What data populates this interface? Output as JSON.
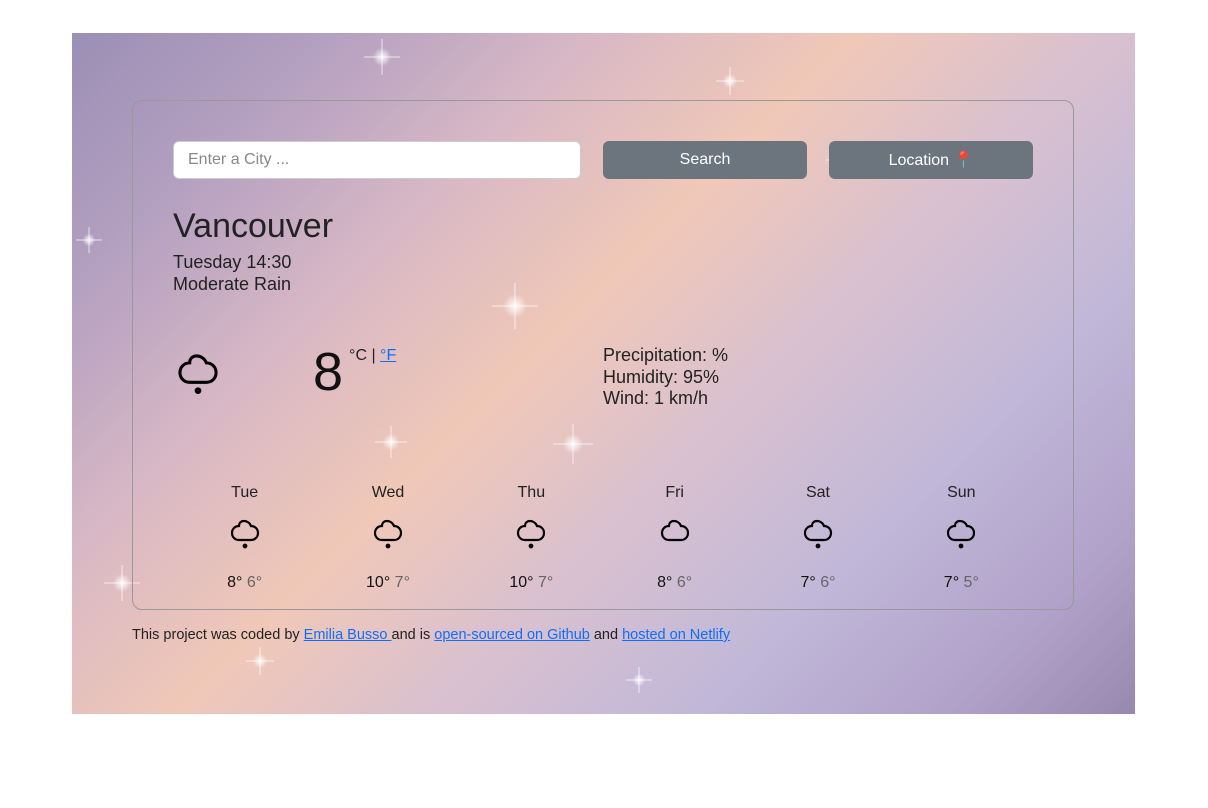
{
  "search": {
    "placeholder": "Enter a City ...",
    "search_label": "Search",
    "location_label": "Location 📍"
  },
  "current": {
    "city": "Vancouver",
    "datetime": "Tuesday 14:30",
    "description": "Moderate Rain",
    "temperature": "8",
    "unit_c": "°C",
    "unit_sep": " | ",
    "unit_f_link": "°F",
    "precipitation_label": "Precipitation: %",
    "humidity_label": "Humidity: 95%",
    "wind_label": "Wind: 1 km/h",
    "icon": "rain"
  },
  "forecast": [
    {
      "day": "Tue",
      "icon": "rain",
      "max": "8°",
      "min": "6°"
    },
    {
      "day": "Wed",
      "icon": "rain",
      "max": "10°",
      "min": "7°"
    },
    {
      "day": "Thu",
      "icon": "rain",
      "max": "10°",
      "min": "7°"
    },
    {
      "day": "Fri",
      "icon": "cloudy",
      "max": "8°",
      "min": "6°"
    },
    {
      "day": "Sat",
      "icon": "rain",
      "max": "7°",
      "min": "6°"
    },
    {
      "day": "Sun",
      "icon": "rain",
      "max": "7°",
      "min": "5°"
    }
  ],
  "footer": {
    "text_prefix": "This project was coded by ",
    "author_link": "Emilia Busso ",
    "text_mid1": "and is ",
    "github_link": "open-sourced on Github",
    "text_mid2": " and ",
    "netlify_link": "hosted on Netlify"
  }
}
